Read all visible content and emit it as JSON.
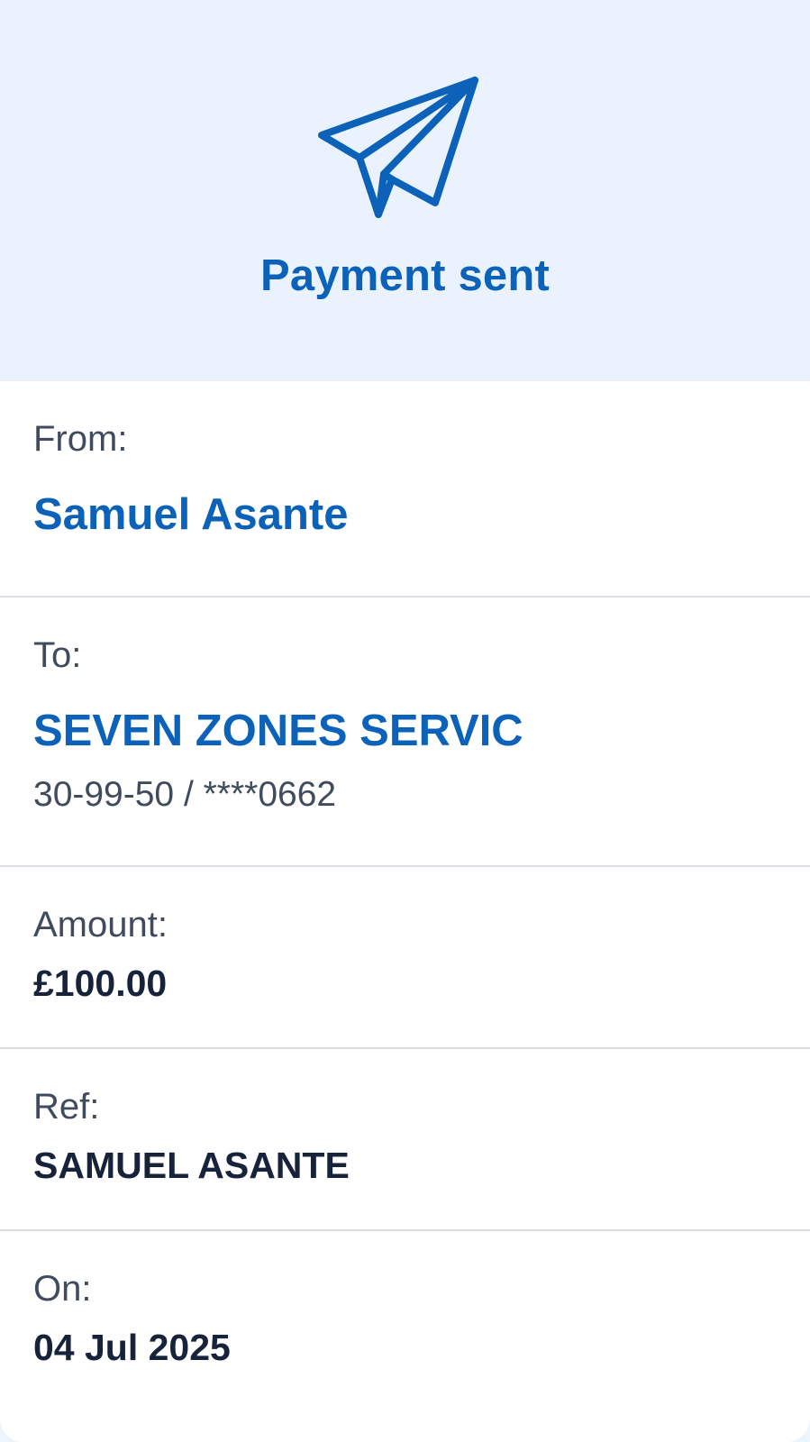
{
  "header": {
    "icon": "paper-plane-icon",
    "title": "Payment sent",
    "background": "#eaf3fd",
    "accent": "#0c62b8"
  },
  "details": {
    "from": {
      "label": "From:",
      "value": "Samuel Asante"
    },
    "to": {
      "label": "To:",
      "value": "SEVEN ZONES SERVIC",
      "account": "30-99-50 / ****0662"
    },
    "amount": {
      "label": "Amount:",
      "value": "£100.00"
    },
    "ref": {
      "label": "Ref:",
      "value": "SAMUEL ASANTE"
    },
    "on": {
      "label": "On:",
      "value": "04 Jul 2025"
    }
  }
}
